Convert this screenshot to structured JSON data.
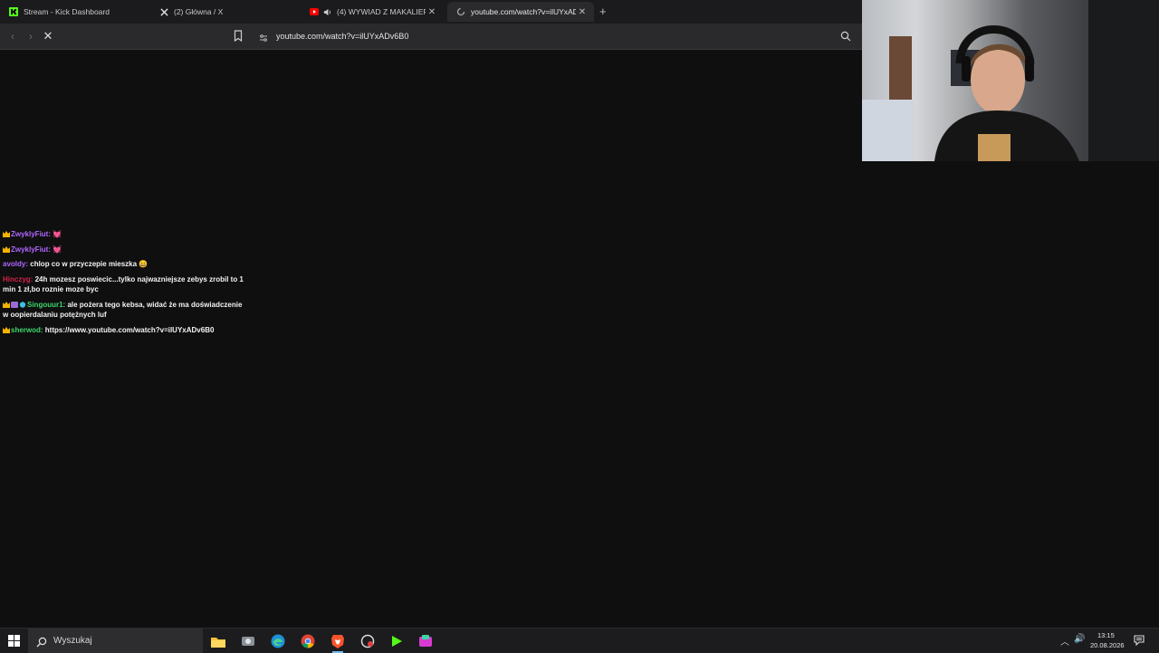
{
  "browser": {
    "tabs": [
      {
        "title": "Stream - Kick Dashboard",
        "icon": "kick-icon"
      },
      {
        "title": "(2) Główna / X",
        "icon": "x-icon"
      },
      {
        "title": "(4) WYWIAD Z MAKALIEREM",
        "icon": "youtube-icon",
        "audio": "speaker-icon"
      },
      {
        "title": "youtube.com/watch?v=ilUYxADv",
        "icon": "loading-icon",
        "active": true
      }
    ],
    "new_tab": "+",
    "url": "youtube.com/watch?v=ilUYxADv6B0"
  },
  "chat": {
    "messages": [
      {
        "user": "ZwyklyFiut:",
        "text": "",
        "user_color": "#b066ff",
        "emote": "💓"
      },
      {
        "user": "ZwyklyFiut:",
        "text": "",
        "user_color": "#b066ff",
        "emote": "💓"
      },
      {
        "user": "avoldy:",
        "text": "chlop co w przyczepie mieszka",
        "user_color": "#b066ff",
        "emote": "😄"
      },
      {
        "user": "Hinczyg:",
        "text": "24h mozesz poswiecic...tylko najwazniejsze zebys zrobil to 1 min 1 zł,bo roznie moze byc",
        "user_color": "#d0234a"
      },
      {
        "user": "Singouur1:",
        "text": "ale pożera tego kebsa, widać że ma doświadczenie w oopierdalaniu potężnych luf",
        "user_color": "#3dd66b"
      },
      {
        "user": "sherwod:",
        "text": "https://www.youtube.com/watch?v=ilUYxADv6B0",
        "user_color": "#3dd66b"
      }
    ]
  },
  "taskbar": {
    "search_placeholder": "Wyszukaj",
    "apps": [
      "file-explorer-icon",
      "screenshot-tool-icon",
      "edge-icon",
      "chrome-icon",
      "brave-icon",
      "media-icon",
      "kick-app-icon",
      "streaming-app-icon"
    ],
    "time": "13:15",
    "date": "20.08.2026"
  },
  "colors": {
    "kick_green": "#53fc18",
    "youtube_red": "#ff0000"
  }
}
